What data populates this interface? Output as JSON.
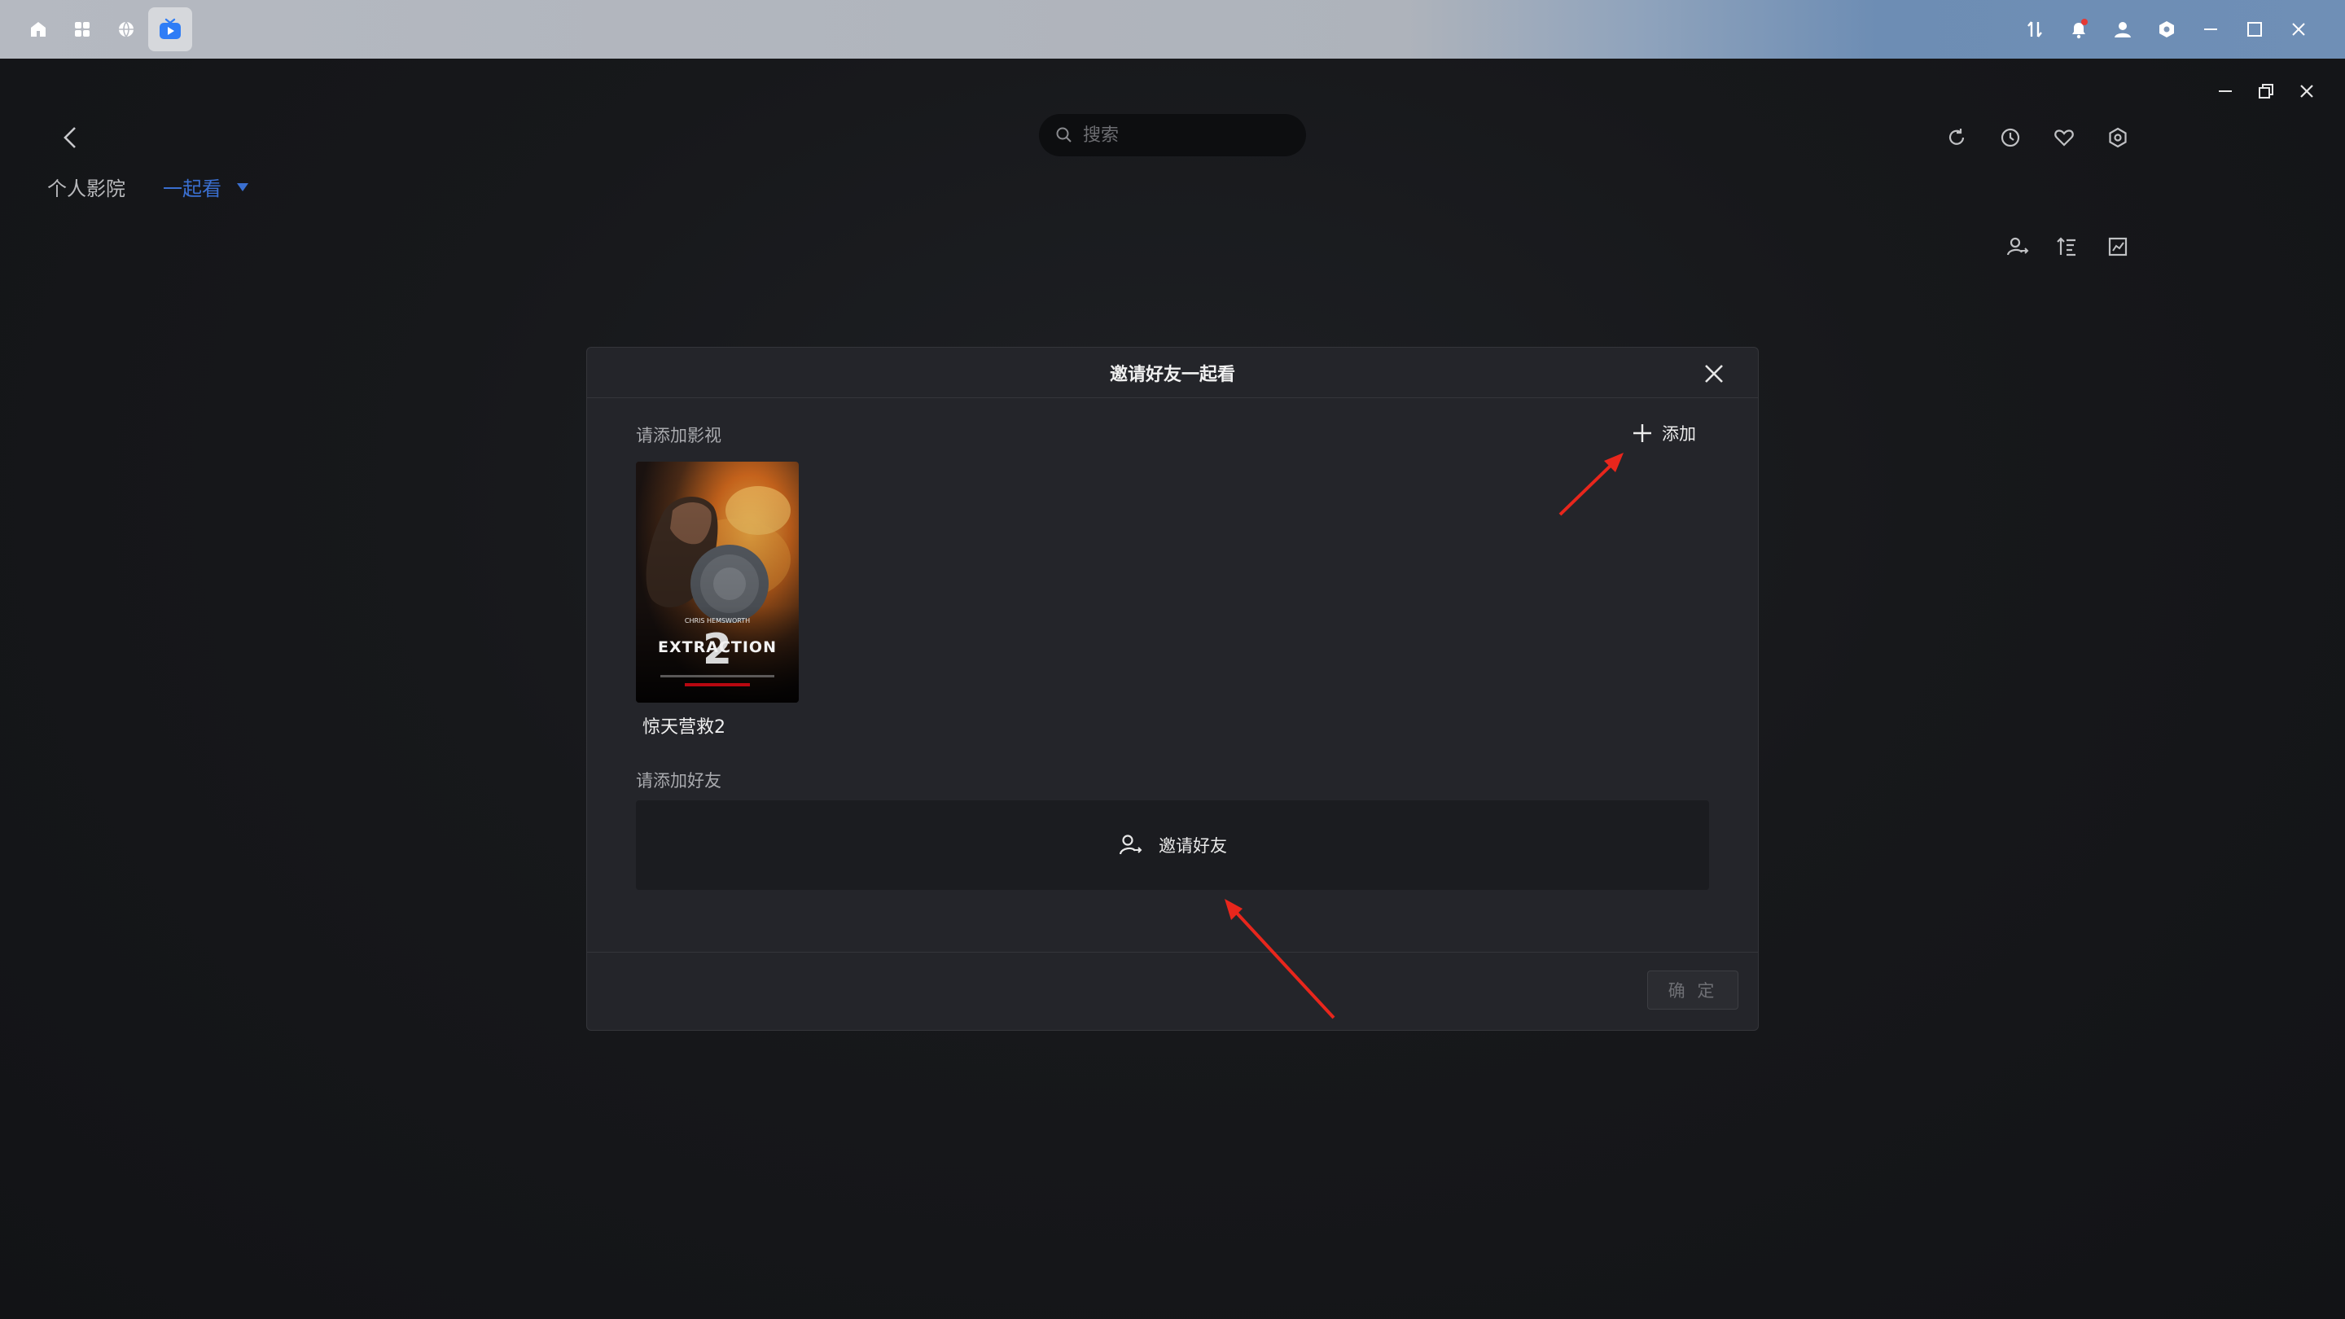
{
  "os_bar": {
    "left_icons": [
      "home-icon",
      "apps-grid-icon",
      "globe-icon",
      "tv-app-icon"
    ],
    "right_icons": [
      "transfer-icon",
      "bell-icon",
      "user-icon",
      "settings-hex-icon",
      "minimize-icon",
      "maximize-icon",
      "close-icon"
    ],
    "notification_dot_color": "#e53935"
  },
  "window": {
    "controls": [
      "minimize-icon",
      "restore-icon",
      "close-icon"
    ]
  },
  "header": {
    "search_placeholder": "搜索",
    "actions": [
      "refresh-icon",
      "history-clock-icon",
      "heart-icon",
      "settings-hex-icon"
    ]
  },
  "tabs": [
    {
      "label": "个人影院",
      "active": false
    },
    {
      "label": "一起看",
      "active": true
    }
  ],
  "sub_actions": [
    "user-share-icon",
    "sort-list-icon",
    "chart-icon"
  ],
  "modal": {
    "title": "邀请好友一起看",
    "media_section_label": "请添加影视",
    "add_label": "添加",
    "movie": {
      "title": "惊天营救2",
      "poster_text": "EXTRACTION",
      "poster_number": "2"
    },
    "friends_section_label": "请添加好友",
    "invite_label": "邀请好友",
    "confirm_label": "确 定"
  },
  "colors": {
    "accent": "#3a6fd0",
    "annotation_arrow": "#e8261c"
  }
}
